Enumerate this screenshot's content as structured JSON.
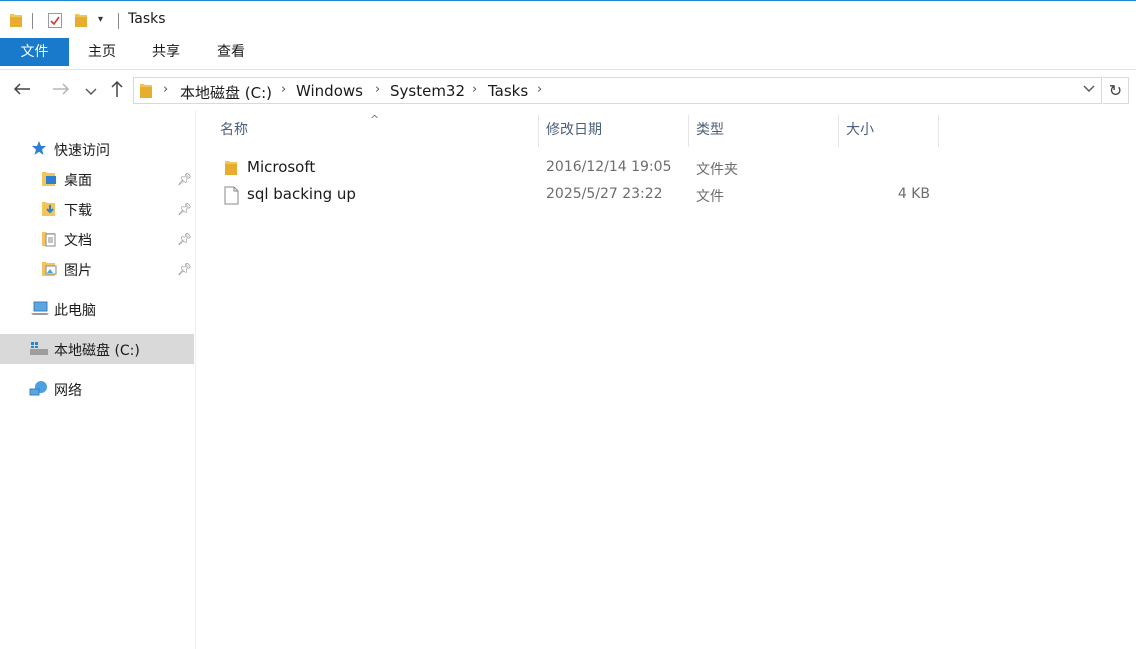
{
  "window": {
    "title": "Tasks"
  },
  "ribbon": {
    "tabs": [
      "文件",
      "主页",
      "共享",
      "查看"
    ]
  },
  "address": {
    "crumbs": [
      "本地磁盘 (C:)",
      "Windows",
      "System32",
      "Tasks"
    ]
  },
  "sidebar": {
    "quick_access": "快速访问",
    "pinned": [
      "桌面",
      "下载",
      "文档",
      "图片"
    ],
    "this_pc": "此电脑",
    "local_disk": "本地磁盘 (C:)",
    "network": "网络"
  },
  "columns": {
    "name": "名称",
    "date": "修改日期",
    "type": "类型",
    "size": "大小"
  },
  "files": [
    {
      "name": "Microsoft",
      "date": "2016/12/14 19:05",
      "type": "文件夹",
      "size": "",
      "icon": "folder-icon"
    },
    {
      "name": "sql backing up",
      "date": "2025/5/27 23:22",
      "type": "文件",
      "size": "4 KB",
      "icon": "file-icon"
    }
  ],
  "colors": {
    "accent": "#1979ca",
    "selected": "#d9d9d9",
    "folder": "#f2c55c"
  }
}
